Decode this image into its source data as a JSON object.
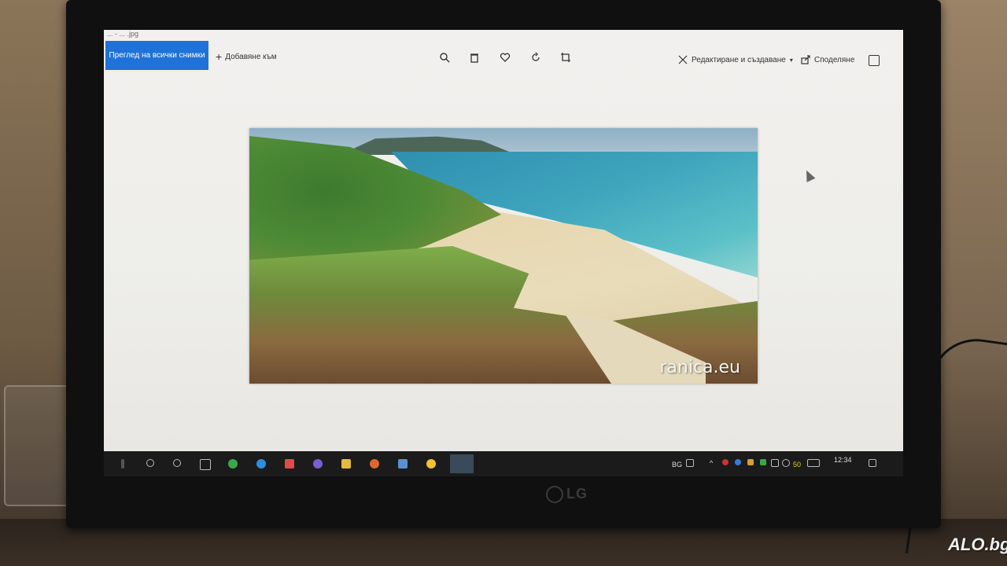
{
  "window": {
    "title": "... - ... .jpg"
  },
  "toolbar": {
    "view_all_label": "Преглед на всички снимки",
    "add_to_label": "Добавяне към",
    "edit_create_label": "Редактиране и създаване",
    "share_label": "Споделяне"
  },
  "photo": {
    "watermark": "ranica.eu"
  },
  "taskbar": {
    "language": "BG",
    "battery_or_temp": "50",
    "time": "12:34"
  },
  "monitor": {
    "brand": "LG"
  },
  "corner_watermark": "ALO.bg"
}
